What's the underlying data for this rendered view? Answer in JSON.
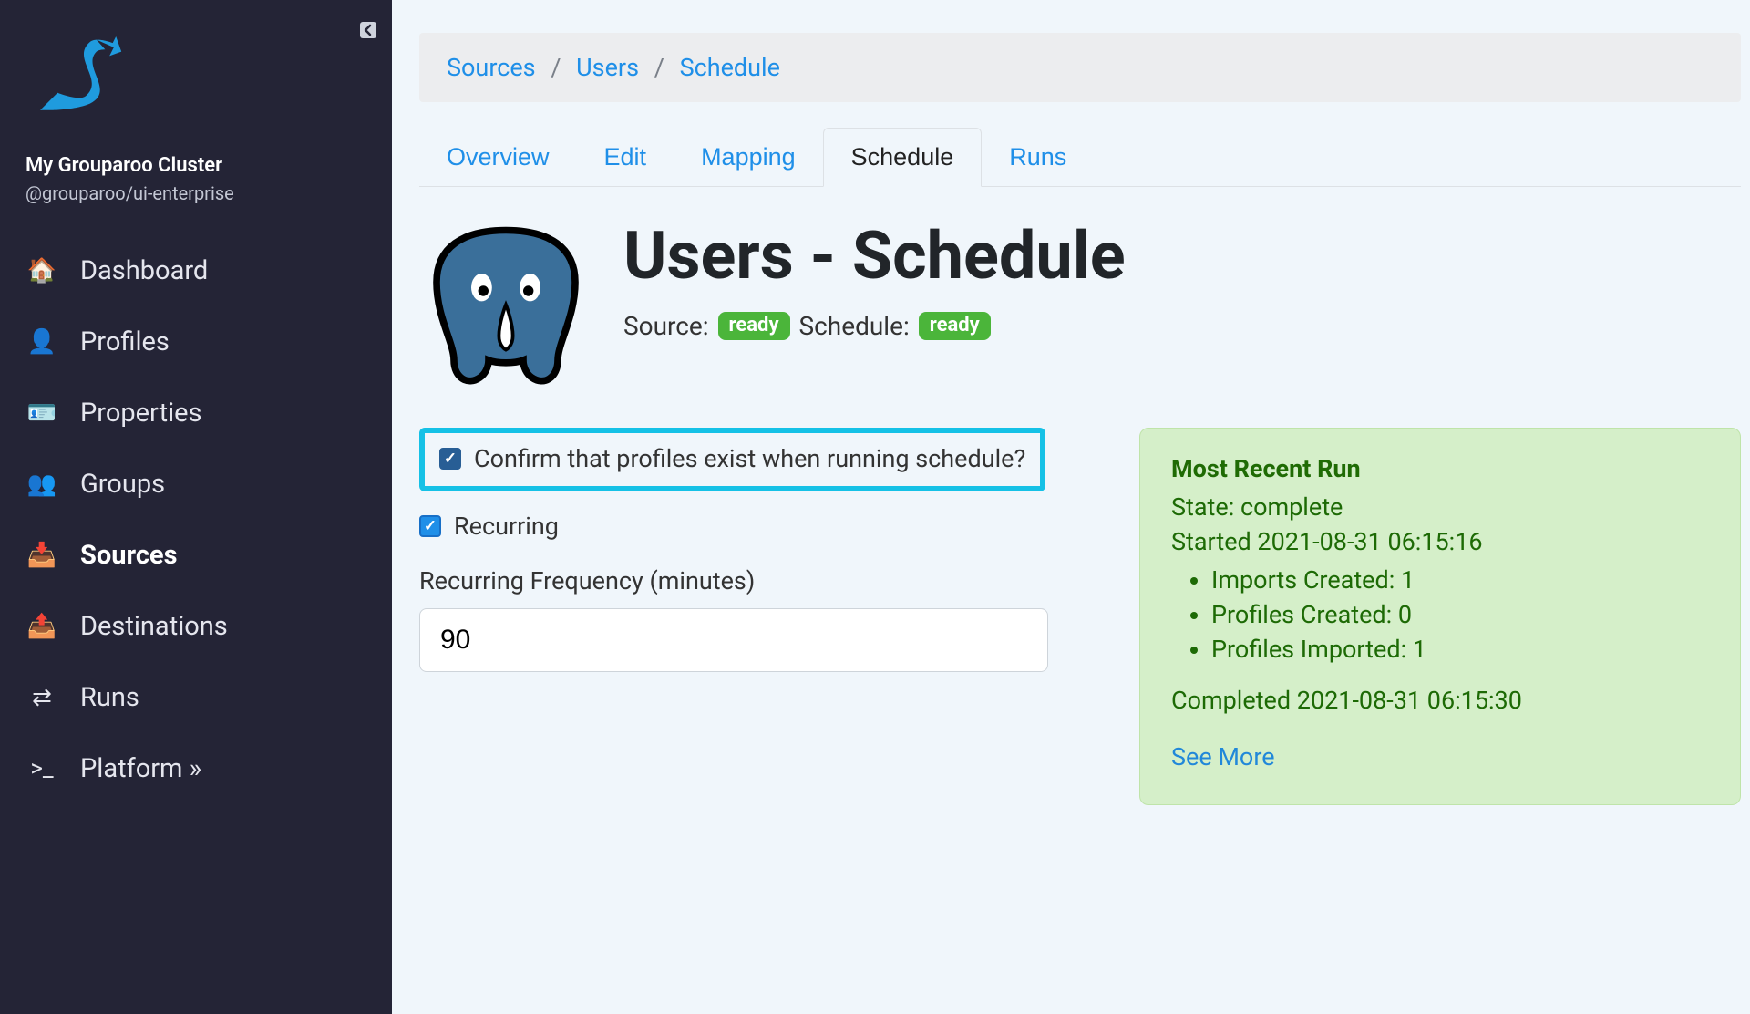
{
  "sidebar": {
    "cluster_name": "My Grouparoo Cluster",
    "package": "@grouparoo/ui-enterprise",
    "items": [
      {
        "icon": "home",
        "label": "Dashboard"
      },
      {
        "icon": "user",
        "label": "Profiles"
      },
      {
        "icon": "id",
        "label": "Properties"
      },
      {
        "icon": "users",
        "label": "Groups"
      },
      {
        "icon": "import",
        "label": "Sources"
      },
      {
        "icon": "export",
        "label": "Destinations"
      },
      {
        "icon": "swap",
        "label": "Runs"
      },
      {
        "icon": "terminal",
        "label": "Platform »"
      }
    ],
    "active_index": 4
  },
  "breadcrumbs": {
    "items": [
      "Sources",
      "Users",
      "Schedule"
    ]
  },
  "tabs": {
    "items": [
      "Overview",
      "Edit",
      "Mapping",
      "Schedule",
      "Runs"
    ],
    "active_index": 3
  },
  "header": {
    "title": "Users - Schedule",
    "source_label": "Source:",
    "source_badge": "ready",
    "schedule_label": "Schedule:",
    "schedule_badge": "ready"
  },
  "form": {
    "confirm_label": "Confirm that profiles exist when running schedule?",
    "confirm_checked": true,
    "recurring_label": "Recurring",
    "recurring_checked": true,
    "frequency_label": "Recurring Frequency (minutes)",
    "frequency_value": "90"
  },
  "recent_run": {
    "title": "Most Recent Run",
    "state_line": "State: complete",
    "started_line": "Started 2021-08-31 06:15:16",
    "imports_line": "Imports Created: 1",
    "profiles_created_line": "Profiles Created: 0",
    "profiles_imported_line": "Profiles Imported: 1",
    "completed_line": "Completed 2021-08-31 06:15:30",
    "see_more": "See More"
  },
  "icons": {
    "home": "🏠",
    "user": "👤",
    "id": "🪪",
    "users": "👥",
    "import": "📥",
    "export": "📤",
    "swap": "⇄",
    "terminal": ">_"
  }
}
